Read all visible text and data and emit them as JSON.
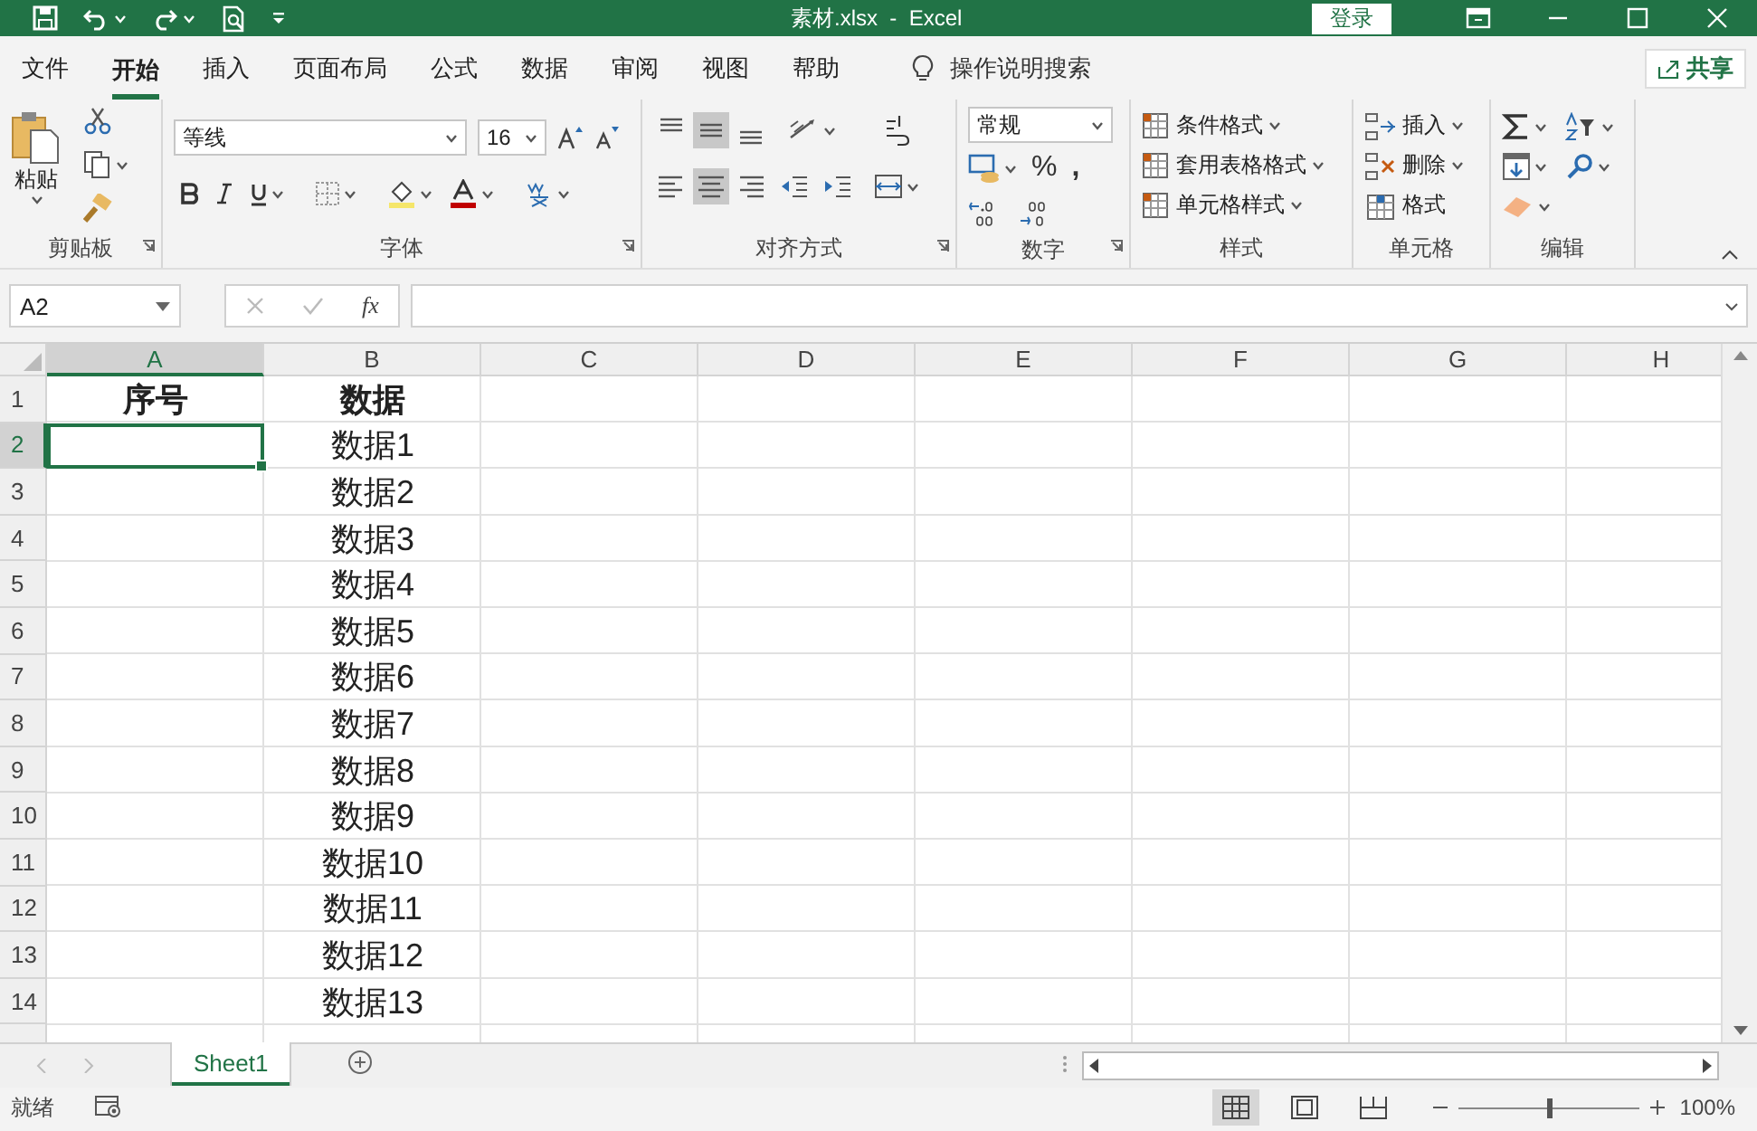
{
  "title_bar": {
    "title": "素材.xlsx  -  Excel",
    "sign_in": "登录"
  },
  "menu_tabs": [
    {
      "label": "文件",
      "selected": false
    },
    {
      "label": "开始",
      "selected": true
    },
    {
      "label": "插入",
      "selected": false
    },
    {
      "label": "页面布局",
      "selected": false
    },
    {
      "label": "公式",
      "selected": false
    },
    {
      "label": "数据",
      "selected": false
    },
    {
      "label": "审阅",
      "selected": false
    },
    {
      "label": "视图",
      "selected": false
    },
    {
      "label": "帮助",
      "selected": false
    }
  ],
  "search": {
    "placeholder": "操作说明搜索"
  },
  "share": "共享",
  "ribbon": {
    "clipboard": {
      "paste": "粘贴",
      "label": "剪贴板"
    },
    "font": {
      "font_name": "等线",
      "font_size": "16",
      "label": "字体"
    },
    "alignment": {
      "label": "对齐方式",
      "vertical_align": [
        {
          "kind": "top",
          "selected": false
        },
        {
          "kind": "middle",
          "selected": true
        },
        {
          "kind": "bottom",
          "selected": false
        }
      ],
      "horizontal_align": [
        {
          "kind": "left",
          "selected": false
        },
        {
          "kind": "center",
          "selected": true
        },
        {
          "kind": "right",
          "selected": false
        }
      ]
    },
    "number": {
      "format": "常规",
      "percent": "%",
      "comma": ",",
      "label": "数字"
    },
    "styles": {
      "items": [
        "条件格式",
        "套用表格格式",
        "单元格样式"
      ],
      "label": "样式"
    },
    "cells": {
      "items": [
        "插入",
        "删除",
        "格式"
      ],
      "label": "单元格"
    },
    "editing": {
      "label": "编辑"
    }
  },
  "formula_bar": {
    "name_box": "A2",
    "function_label": "fx"
  },
  "sheet": {
    "columns": [
      {
        "label": "A",
        "selected": true
      },
      {
        "label": "B",
        "selected": false
      },
      {
        "label": "C",
        "selected": false
      },
      {
        "label": "D",
        "selected": false
      },
      {
        "label": "E",
        "selected": false
      },
      {
        "label": "F",
        "selected": false
      },
      {
        "label": "G",
        "selected": false
      },
      {
        "label": "H",
        "selected": false
      }
    ],
    "rows": [
      {
        "number": "1",
        "kind": "header",
        "selected": false,
        "cells": {
          "A": "序号",
          "B": "数据"
        }
      },
      {
        "number": "2",
        "kind": "data",
        "selected": true,
        "cells": {
          "B": "数据1"
        }
      },
      {
        "number": "3",
        "kind": "data",
        "selected": false,
        "cells": {
          "B": "数据2"
        }
      },
      {
        "number": "4",
        "kind": "data",
        "selected": false,
        "cells": {
          "B": "数据3"
        }
      },
      {
        "number": "5",
        "kind": "data",
        "selected": false,
        "cells": {
          "B": "数据4"
        }
      },
      {
        "number": "6",
        "kind": "data",
        "selected": false,
        "cells": {
          "B": "数据5"
        }
      },
      {
        "number": "7",
        "kind": "data",
        "selected": false,
        "cells": {
          "B": "数据6"
        }
      },
      {
        "number": "8",
        "kind": "data",
        "selected": false,
        "cells": {
          "B": "数据7"
        }
      },
      {
        "number": "9",
        "kind": "data",
        "selected": false,
        "cells": {
          "B": "数据8"
        }
      },
      {
        "number": "10",
        "kind": "data",
        "selected": false,
        "cells": {
          "B": "数据9"
        }
      },
      {
        "number": "11",
        "kind": "data",
        "selected": false,
        "cells": {
          "B": "数据10"
        }
      },
      {
        "number": "12",
        "kind": "data",
        "selected": false,
        "cells": {
          "B": "数据11"
        }
      },
      {
        "number": "13",
        "kind": "data",
        "selected": false,
        "cells": {
          "B": "数据12"
        }
      },
      {
        "number": "14",
        "kind": "data",
        "selected": false,
        "cells": {
          "B": "数据13"
        }
      }
    ]
  },
  "sheet_tabs": [
    {
      "name": "Sheet1",
      "selected": true
    }
  ],
  "status_bar": {
    "text": "就绪",
    "zoom": "100%",
    "zoom_slider": {
      "level": 0.5
    },
    "view_buttons": [
      {
        "kind": "normal",
        "selected": true
      },
      {
        "kind": "page_layout",
        "selected": false
      },
      {
        "kind": "page_break",
        "selected": false
      }
    ]
  }
}
